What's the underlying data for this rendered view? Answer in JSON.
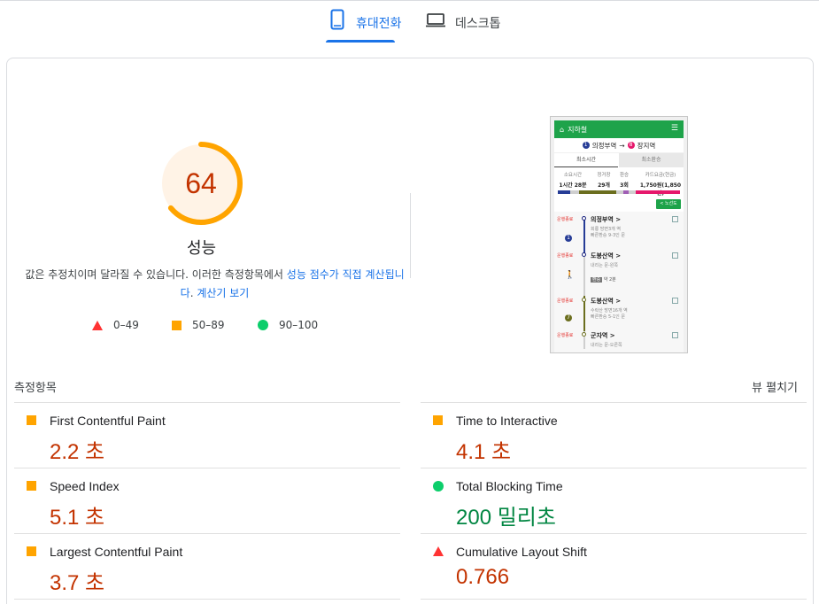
{
  "tabs": {
    "mobile_label": "휴대전화",
    "desktop_label": "데스크톱"
  },
  "performance": {
    "score": "64",
    "score_fraction": 0.64,
    "title": "성능",
    "desc_prefix": "값은 추정치이며 달라질 수 있습니다. 이러한 측정항목에서 ",
    "desc_link1": "성능 점수가 직접 계산됩니",
    "desc_link1b": "다",
    "desc_mid": ". ",
    "desc_link2": "계산기 보기"
  },
  "legend": {
    "fail": "0–49",
    "average": "50–89",
    "pass": "90–100"
  },
  "screenshot": {
    "header_title": "지하철",
    "route_from_num": "1",
    "route_from": "의정부역",
    "route_arrow": "→",
    "route_to_num": "8",
    "route_to": "장지역",
    "tab1": "최소시간",
    "tab2": "최소환승",
    "stat1_label": "소요시간",
    "stat1_value": "1시간 28분",
    "stat2_label": "정거장",
    "stat2_value": "29개",
    "stat3_label": "환승",
    "stat3_value": "3회",
    "stat4_label": "카드요금(현금)",
    "stat4_value": "1,750원(1,850원)",
    "route_button": "< 노선도",
    "stations": [
      {
        "tag": "운행종료",
        "name": "의정부역 >",
        "sub1": "회룡 방면3개 역",
        "sub2": "빠른환승 9-3인 문"
      },
      {
        "tag": "운행종료",
        "name": "도봉산역 >",
        "sub1": "내리는 문-왼쪽",
        "sub2": "약 2분"
      },
      {
        "tag": "운행종료",
        "name": "도봉산역 >",
        "sub1": "수락산 방면16개 역",
        "sub2": "빠른환승 5-1인 문"
      },
      {
        "tag": "운행종료",
        "name": "군자역 >",
        "sub1": "내리는 문-오른쪽",
        "sub2": ""
      }
    ],
    "walk_label": "환승"
  },
  "metrics_header": {
    "title": "측정항목",
    "expand": "뷰 펼치기"
  },
  "metrics": [
    {
      "name": "First Contentful Paint",
      "value": "2.2 초",
      "status": "average"
    },
    {
      "name": "Time to Interactive",
      "value": "4.1 초",
      "status": "average"
    },
    {
      "name": "Speed Index",
      "value": "5.1 초",
      "status": "average"
    },
    {
      "name": "Total Blocking Time",
      "value": "200 밀리초",
      "status": "pass"
    },
    {
      "name": "Largest Contentful Paint",
      "value": "3.7 초",
      "status": "average"
    },
    {
      "name": "Cumulative Layout Shift",
      "value": "0.766",
      "status": "fail"
    }
  ],
  "colors": {
    "accent": "#1a73e8",
    "fail": "#ff3333",
    "average": "#ffa400",
    "pass": "#0cce6b",
    "average_text": "#c33300",
    "pass_text": "#018642"
  }
}
